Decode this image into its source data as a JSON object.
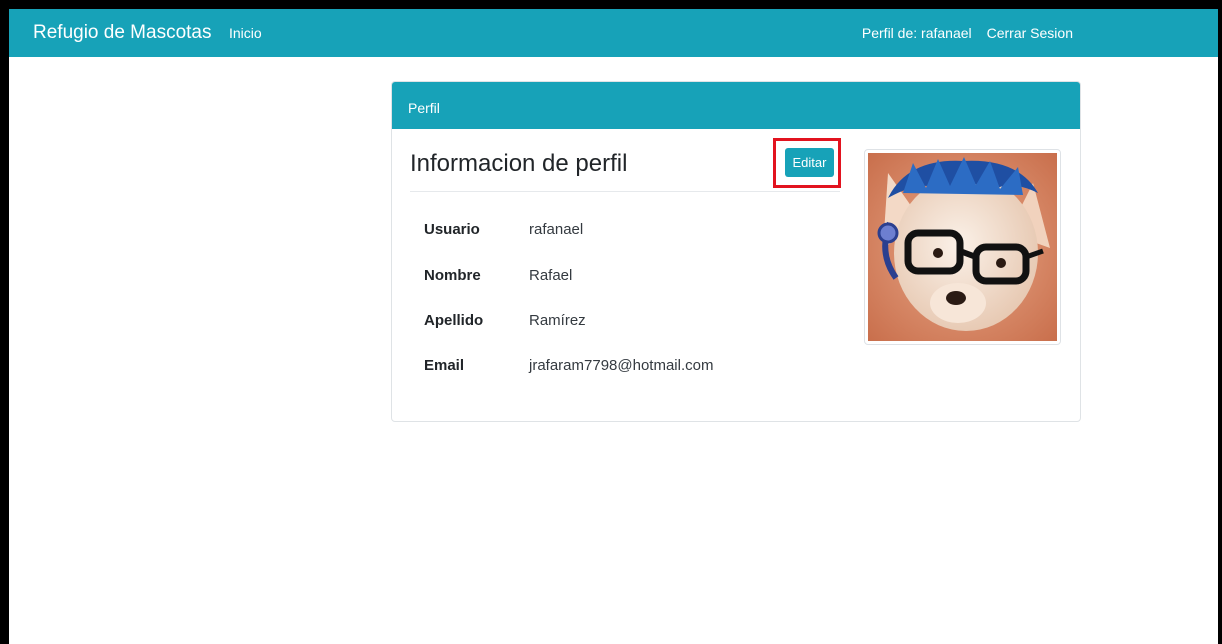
{
  "navbar": {
    "brand": "Refugio de Mascotas",
    "home_link": "Inicio",
    "profile_label": "Perfil de: rafanael",
    "logout_link": "Cerrar Sesion",
    "color": "#17a2b8"
  },
  "card": {
    "header": "Perfil",
    "title": "Informacion de perfil",
    "edit_button": "Editar",
    "highlight_color": "#e2131f",
    "fields": [
      {
        "label": "Usuario",
        "value": "rafanael"
      },
      {
        "label": "Nombre",
        "value": "Rafael"
      },
      {
        "label": "Apellido",
        "value": "Ramírez"
      },
      {
        "label": "Email",
        "value": "jrafaram7798@hotmail.com"
      }
    ],
    "avatar_icon": "dog-with-glasses-avatar"
  }
}
